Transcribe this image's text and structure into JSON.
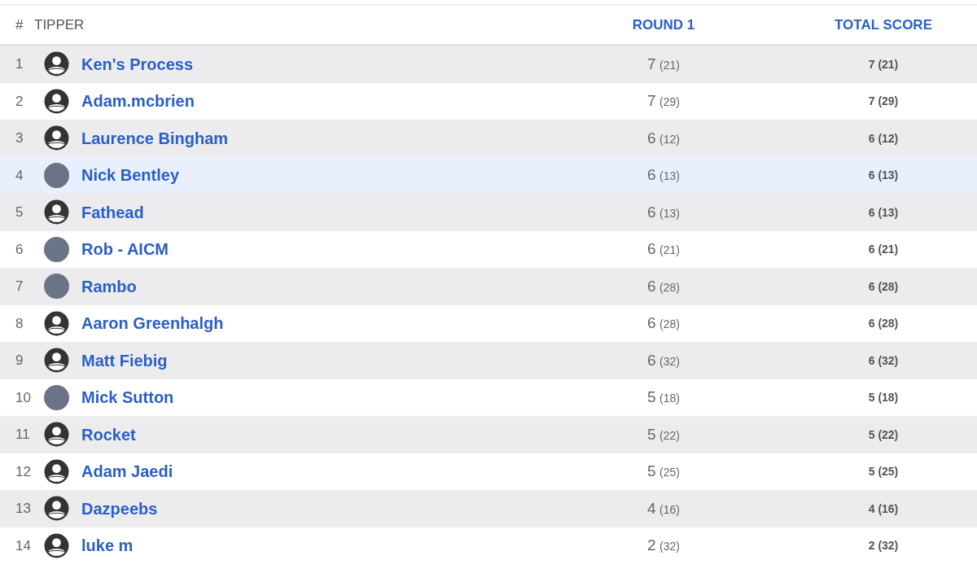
{
  "table": {
    "columns": [
      {
        "label": "#",
        "sortable": false
      },
      {
        "label": "TIPPER",
        "sortable": false
      },
      {
        "label": "ROUND 1",
        "sortable": true
      },
      {
        "label": "TOTAL SCORE",
        "sortable": true
      }
    ],
    "rows": [
      {
        "rank": "1",
        "kind": "default",
        "name": "Ken's Process",
        "round_score": "7",
        "round_margin": "(21)",
        "total_score": "7",
        "total_margin": "(21)",
        "selected": false
      },
      {
        "rank": "2",
        "kind": "default",
        "name": "Adam.mcbrien",
        "round_score": "7",
        "round_margin": "(29)",
        "total_score": "7",
        "total_margin": "(29)",
        "selected": false
      },
      {
        "rank": "3",
        "kind": "default",
        "name": "Laurence Bingham",
        "round_score": "6",
        "round_margin": "(12)",
        "total_score": "6",
        "total_margin": "(12)",
        "selected": false
      },
      {
        "rank": "4",
        "kind": "photo",
        "name": "Nick Bentley",
        "round_score": "6",
        "round_margin": "(13)",
        "total_score": "6",
        "total_margin": "(13)",
        "selected": true
      },
      {
        "rank": "5",
        "kind": "default",
        "name": "Fathead",
        "round_score": "6",
        "round_margin": "(13)",
        "total_score": "6",
        "total_margin": "(13)",
        "selected": false
      },
      {
        "rank": "6",
        "kind": "photo",
        "name": "Rob - AICM",
        "round_score": "6",
        "round_margin": "(21)",
        "total_score": "6",
        "total_margin": "(21)",
        "selected": false
      },
      {
        "rank": "7",
        "kind": "photo",
        "name": "Rambo",
        "round_score": "6",
        "round_margin": "(28)",
        "total_score": "6",
        "total_margin": "(28)",
        "selected": false
      },
      {
        "rank": "8",
        "kind": "default",
        "name": "Aaron Greenhalgh",
        "round_score": "6",
        "round_margin": "(28)",
        "total_score": "6",
        "total_margin": "(28)",
        "selected": false
      },
      {
        "rank": "9",
        "kind": "default",
        "name": "Matt Fiebig",
        "round_score": "6",
        "round_margin": "(32)",
        "total_score": "6",
        "total_margin": "(32)",
        "selected": false
      },
      {
        "rank": "10",
        "kind": "photo",
        "name": "Mick Sutton",
        "round_score": "5",
        "round_margin": "(18)",
        "total_score": "5",
        "total_margin": "(18)",
        "selected": false
      },
      {
        "rank": "11",
        "kind": "default",
        "name": "Rocket",
        "round_score": "5",
        "round_margin": "(22)",
        "total_score": "5",
        "total_margin": "(22)",
        "selected": false
      },
      {
        "rank": "12",
        "kind": "default",
        "name": "Adam Jaedi",
        "round_score": "5",
        "round_margin": "(25)",
        "total_score": "5",
        "total_margin": "(25)",
        "selected": false
      },
      {
        "rank": "13",
        "kind": "default",
        "name": "Dazpeebs",
        "round_score": "4",
        "round_margin": "(16)",
        "total_score": "4",
        "total_margin": "(16)",
        "selected": false
      },
      {
        "rank": "14",
        "kind": "default",
        "name": "luke m",
        "round_score": "2",
        "round_margin": "(32)",
        "total_score": "2",
        "total_margin": "(32)",
        "selected": false
      }
    ]
  }
}
